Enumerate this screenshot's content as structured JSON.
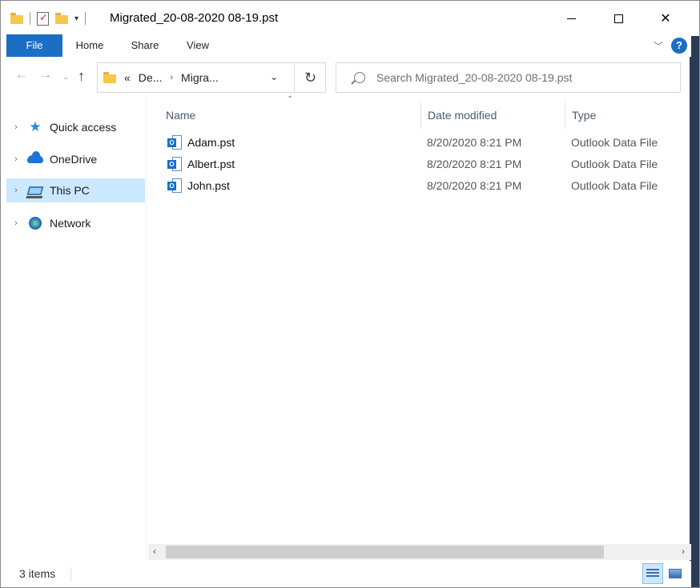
{
  "window": {
    "title": "Migrated_20-08-2020 08-19.pst",
    "controls": [
      "minimize-icon",
      "maximize-icon",
      "close-icon"
    ]
  },
  "ribbon": {
    "tabs": [
      {
        "label": "File"
      },
      {
        "label": "Home"
      },
      {
        "label": "Share"
      },
      {
        "label": "View"
      }
    ],
    "help_label": "?"
  },
  "navigation": {
    "breadcrumb_overflow": "«",
    "breadcrumb": [
      "De...",
      "Migra..."
    ],
    "search_placeholder": "Search Migrated_20-08-2020 08-19.pst"
  },
  "sidebar": {
    "items": [
      {
        "label": "Quick access",
        "icon": "star-icon"
      },
      {
        "label": "OneDrive",
        "icon": "cloud-icon"
      },
      {
        "label": "This PC",
        "icon": "computer-icon",
        "selected": true
      },
      {
        "label": "Network",
        "icon": "network-icon"
      }
    ]
  },
  "file_list": {
    "columns": [
      "Name",
      "Date modified",
      "Type"
    ],
    "rows": [
      {
        "name": "Adam.pst",
        "date": "8/20/2020 8:21 PM",
        "type": "Outlook Data File"
      },
      {
        "name": "Albert.pst",
        "date": "8/20/2020 8:21 PM",
        "type": "Outlook Data File"
      },
      {
        "name": "John.pst",
        "date": "8/20/2020 8:21 PM",
        "type": "Outlook Data File"
      }
    ]
  },
  "status": {
    "item_count": "3 items"
  },
  "colors": {
    "accent": "#1a6fc4",
    "selection": "#cce8ff"
  }
}
